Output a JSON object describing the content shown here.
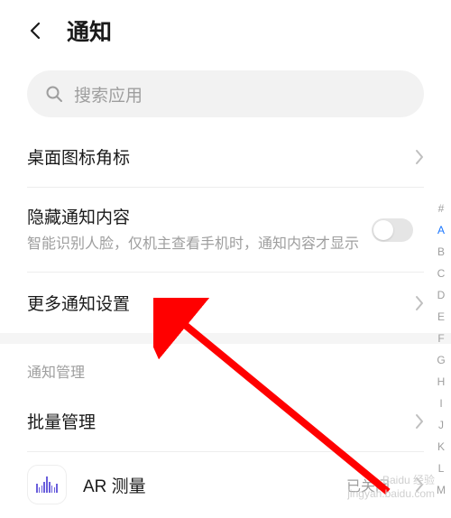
{
  "header": {
    "title": "通知"
  },
  "search": {
    "placeholder": "搜索应用"
  },
  "rows": {
    "desktop_badge": "桌面图标角标",
    "hide_notif_title": "隐藏通知内容",
    "hide_notif_sub": "智能识别人脸，仅机主查看手机时，通知内容才显示",
    "more_settings": "更多通知设置"
  },
  "section": {
    "manage": "通知管理",
    "batch": "批量管理"
  },
  "app": {
    "name": "AR 测量",
    "status": "已关闭"
  },
  "alpha_index": [
    "#",
    "A",
    "B",
    "C",
    "D",
    "E",
    "F",
    "G",
    "H",
    "I",
    "J",
    "K",
    "L",
    "M"
  ],
  "alpha_active_index": 1,
  "watermark": {
    "line1": "Baidu 经验",
    "line2": "jingyan.baidu.com"
  }
}
